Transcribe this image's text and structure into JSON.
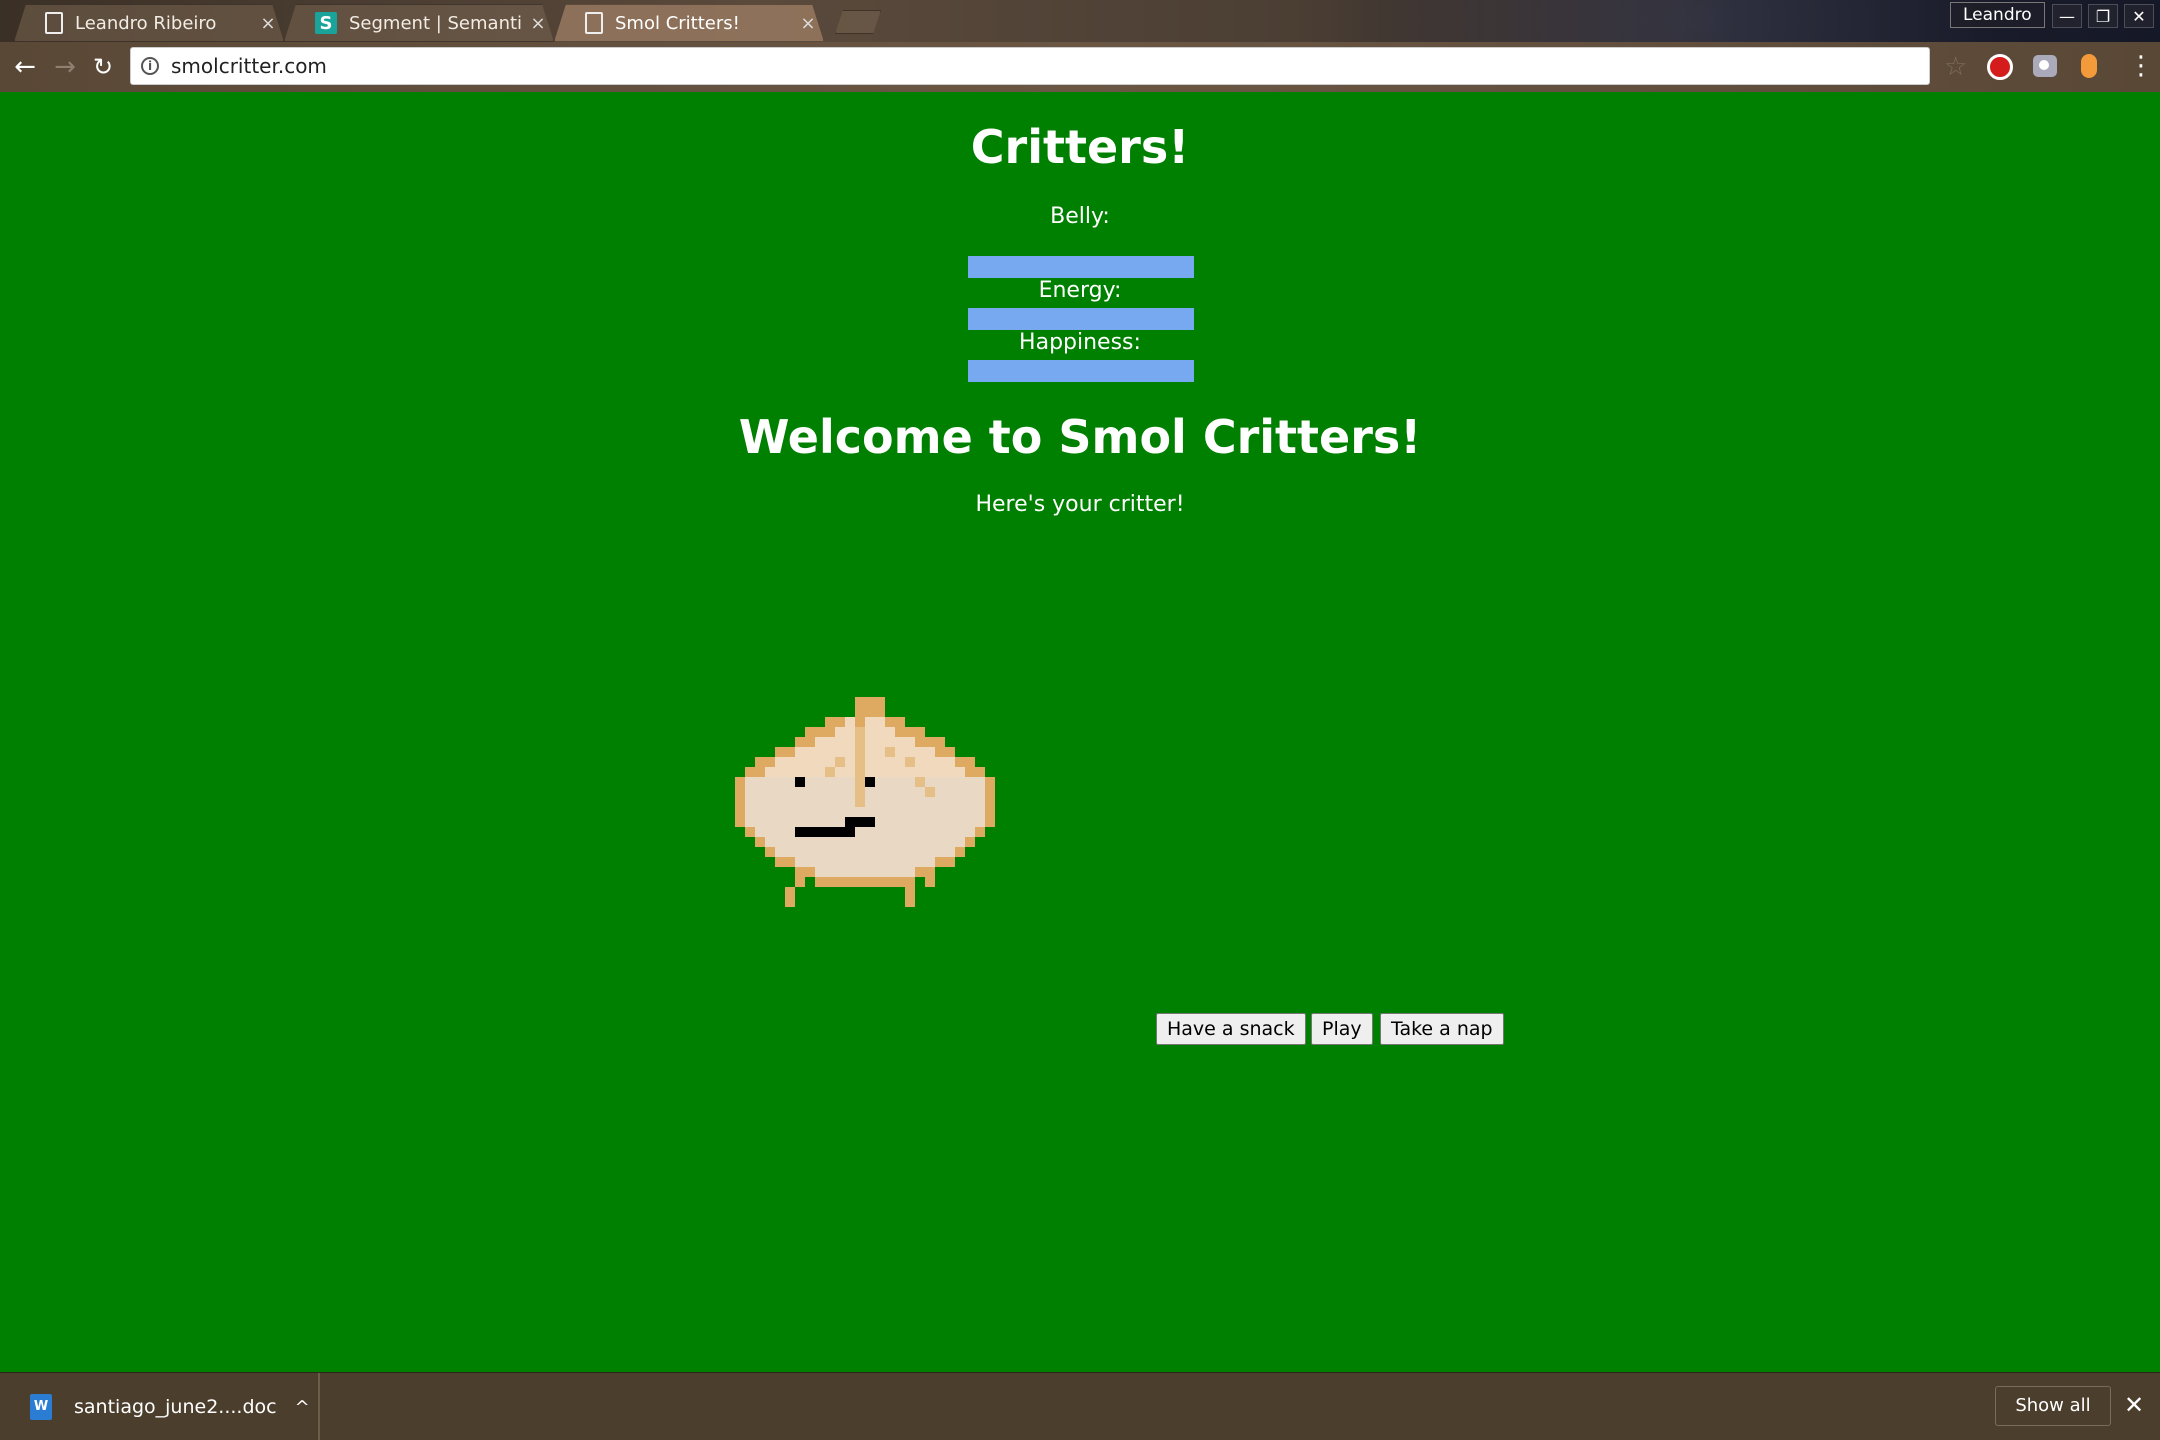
{
  "browser": {
    "tabs": [
      {
        "title": "Leandro Ribeiro",
        "icon": "page-icon"
      },
      {
        "title": "Segment | Semantic",
        "icon": "segment-icon"
      },
      {
        "title": "Smol Critters!",
        "icon": "page-icon"
      }
    ],
    "profile_name": "Leandro",
    "url": "smolcritter.com",
    "close_glyph": "×"
  },
  "page": {
    "title": "Critters!",
    "stats": [
      {
        "label": "Belly:",
        "level": 1.0
      },
      {
        "label": "Energy:",
        "level": 1.0
      },
      {
        "label": "Happiness:",
        "level": 1.0
      }
    ],
    "welcome": "Welcome to Smol Critters!",
    "subtitle": "Here's your critter!",
    "buttons": {
      "snack": "Have a snack",
      "play": "Play",
      "nap": "Take a nap"
    },
    "colors": {
      "background": "#008000",
      "stat_bar": "#76a9ef"
    }
  },
  "downloads": {
    "file_name": "santiago_june2....doc",
    "file_icon_letter": "W",
    "show_all": "Show all"
  }
}
